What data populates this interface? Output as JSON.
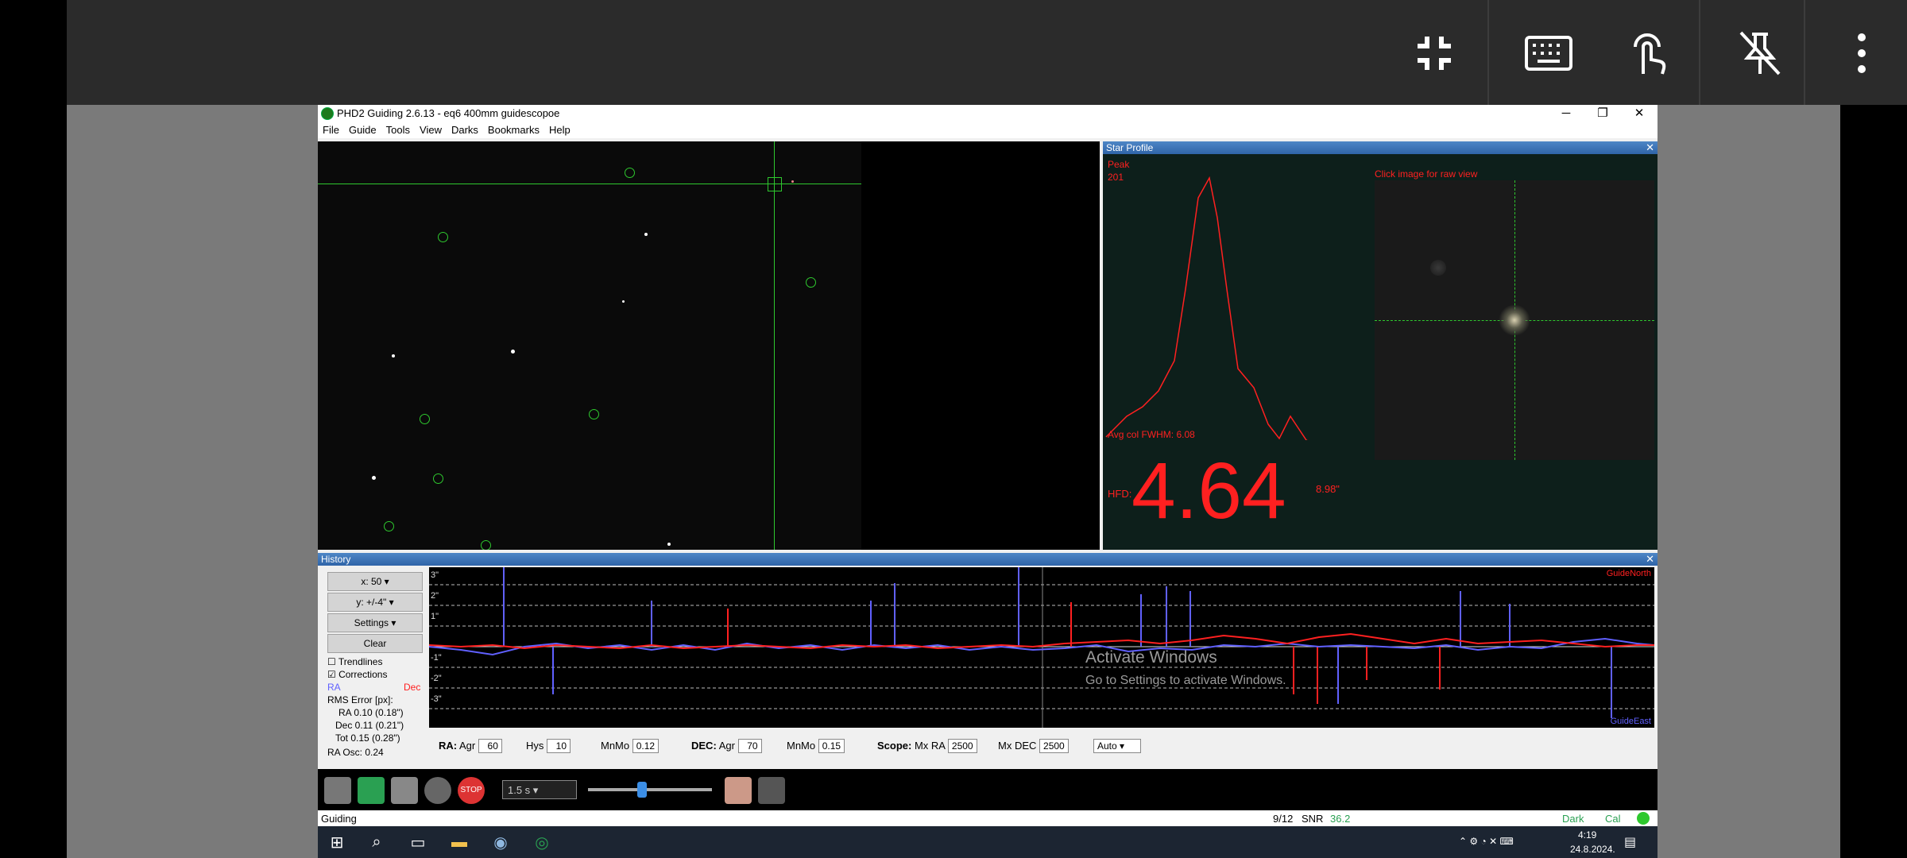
{
  "remote_toolbar": {
    "icons": [
      "exit-fullscreen-icon",
      "keyboard-icon",
      "touch-icon",
      "unpin-icon",
      "more-options-icon"
    ],
    "glyphs": [
      "⤡",
      "⌨",
      "☝",
      "⊘",
      "⋮"
    ]
  },
  "window": {
    "title": "PHD2 Guiding 2.6.13 - eq6 400mm guidescopoe",
    "controls": [
      "─",
      "❐",
      "✕"
    ],
    "menu": [
      "File",
      "Guide",
      "Tools",
      "View",
      "Darks",
      "Bookmarks",
      "Help"
    ]
  },
  "star_profile": {
    "title": "Star Profile",
    "close": "✕",
    "peak_label": "Peak",
    "peak_value": "201",
    "raw_hint": "Click image for raw view",
    "fwhm": "Avg col FWHM: 6.08",
    "hfd_label": "HFD:",
    "hfd_value": "4.64",
    "hfd_arcsec": "8.98\""
  },
  "history": {
    "title": "History",
    "close": "✕",
    "x_scale": "x: 50",
    "y_scale": "y: +/-4\"",
    "settings": "Settings",
    "clear": "Clear",
    "trendlines": "Trendlines",
    "corrections": "Corrections",
    "trendlines_checked": false,
    "corrections_checked": true,
    "ra_label": "RA",
    "dec_label": "Dec",
    "rms_title": "RMS Error [px]:",
    "rms_ra": "RA 0.10 (0.18\")",
    "rms_dec": "Dec 0.11 (0.21\")",
    "rms_tot": "Tot 0.15 (0.28\")",
    "ra_osc": "RA Osc: 0.24",
    "graph_labels": [
      "3\"",
      "2\"",
      "1\"",
      "-1\"",
      "-2\"",
      "-3\""
    ],
    "guide_north": "GuideNorth",
    "guide_east": "GuideEast",
    "colors": {
      "ra": "#6060ff",
      "dec": "#ff2020"
    }
  },
  "controls": {
    "ra_label": "RA:",
    "agr": "Agr",
    "ra_agr": "60",
    "hys": "Hys",
    "ra_hys": "10",
    "mnmo": "MnMo",
    "ra_mnmo": "0.12",
    "dec_label": "DEC:",
    "dec_agr": "70",
    "dec_mnmo": "0.15",
    "scope_label": "Scope:",
    "mx_ra": "Mx RA",
    "mx_ra_val": "2500",
    "mx_dec": "Mx DEC",
    "mx_dec_val": "2500",
    "mode": "Auto"
  },
  "toolbar": {
    "exposure": "1.5 s",
    "icons": [
      "guide-icon",
      "loop-icon",
      "auto-select-star-icon",
      "crosshair-icon",
      "stop-icon",
      "brain-icon",
      "wrench-icon"
    ],
    "stop_text": "STOP"
  },
  "watermark": {
    "line1": "Activate Windows",
    "line2": "Go to Settings to activate Windows."
  },
  "status": {
    "state": "Guiding",
    "frames": "9/12",
    "snr_label": "SNR",
    "snr_value": "36.2",
    "dark": "Dark",
    "cal": "Cal"
  },
  "taskbar": {
    "icons": [
      "windows-start-icon",
      "search-icon",
      "task-view-icon",
      "file-explorer-icon",
      "app-icon-1",
      "phd2-icon"
    ],
    "time": "4:19",
    "date": "24.8.2024."
  }
}
